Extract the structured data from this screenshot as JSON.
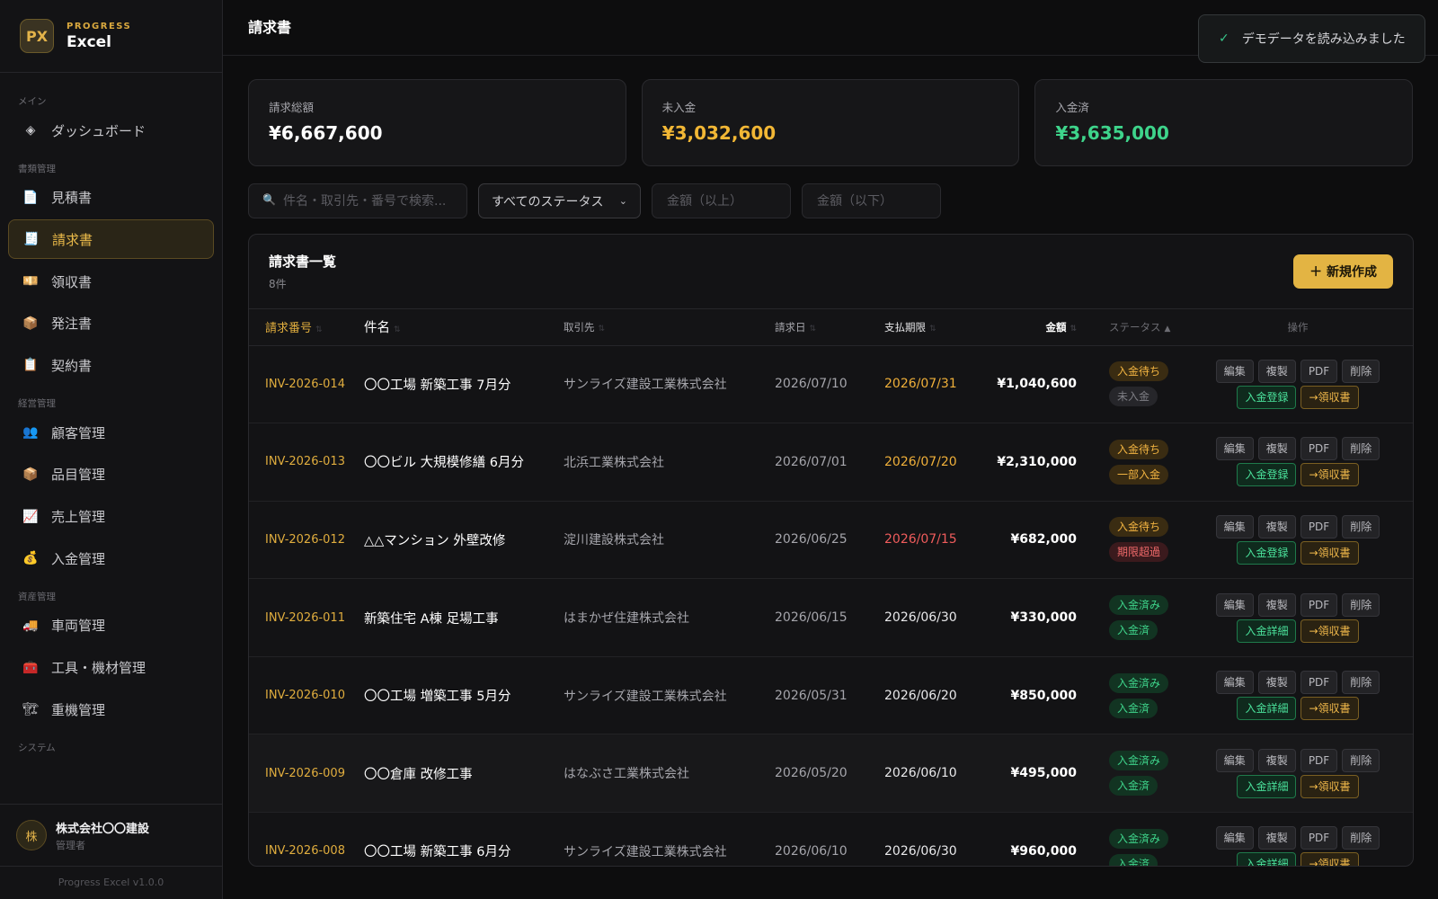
{
  "brand": {
    "logo": "PX",
    "sub": "PROGRESS",
    "name": "Excel"
  },
  "sidebar": {
    "sections": [
      {
        "label": "メイン",
        "items": [
          {
            "icon": "◈",
            "icon_name": "diamond-icon",
            "label": "ダッシュボード"
          }
        ]
      },
      {
        "label": "書類管理",
        "items": [
          {
            "icon": "📄",
            "icon_name": "document-icon",
            "label": "見積書"
          },
          {
            "icon": "🧾",
            "icon_name": "invoice-icon",
            "label": "請求書",
            "active": true
          },
          {
            "icon": "💴",
            "icon_name": "receipt-icon",
            "label": "領収書"
          },
          {
            "icon": "📦",
            "icon_name": "package-icon",
            "label": "発注書"
          },
          {
            "icon": "📋",
            "icon_name": "clipboard-icon",
            "label": "契約書"
          }
        ]
      },
      {
        "label": "経営管理",
        "items": [
          {
            "icon": "👥",
            "icon_name": "users-icon",
            "label": "顧客管理"
          },
          {
            "icon": "📦",
            "icon_name": "box-icon",
            "label": "品目管理"
          },
          {
            "icon": "📈",
            "icon_name": "chart-icon",
            "label": "売上管理"
          },
          {
            "icon": "💰",
            "icon_name": "money-bag-icon",
            "label": "入金管理"
          }
        ]
      },
      {
        "label": "資産管理",
        "items": [
          {
            "icon": "🚚",
            "icon_name": "truck-icon",
            "label": "車両管理"
          },
          {
            "icon": "🧰",
            "icon_name": "toolbox-icon",
            "label": "工具・機材管理"
          },
          {
            "icon": "🏗",
            "icon_name": "crane-icon",
            "label": "重機管理"
          }
        ]
      },
      {
        "label": "システム",
        "items": []
      }
    ],
    "user": {
      "avatar": "株",
      "name": "株式会社〇〇建設",
      "role": "管理者"
    },
    "version": "Progress Excel v1.0.0"
  },
  "header": {
    "title": "請求書"
  },
  "toast": {
    "icon": "✓",
    "message": "デモデータを読み込みました"
  },
  "stats": [
    {
      "label": "請求総額",
      "value": "¥6,667,600",
      "color": "#ffffff"
    },
    {
      "label": "未入金",
      "value": "¥3,032,600",
      "color": "#f2b735"
    },
    {
      "label": "入金済",
      "value": "¥3,635,000",
      "color": "#3ed48b"
    }
  ],
  "filters": {
    "search_placeholder": "件名・取引先・番号で検索...",
    "status_selected": "すべてのステータス",
    "amount_min_placeholder": "金額（以上）",
    "amount_max_placeholder": "金額（以下）"
  },
  "list": {
    "title": "請求書一覧",
    "count": "8件",
    "new_button": "＋ 新規作成",
    "columns": [
      "請求番号",
      "件名",
      "取引先",
      "請求日",
      "支払期限",
      "金額",
      "ステータス",
      "操作"
    ],
    "rows": [
      {
        "no": "INV-2026-014",
        "name": "〇〇工場 新築工事 7月分",
        "client": "サンライズ建設工業株式会社",
        "date": "2026/07/10",
        "due": "2026/07/31",
        "due_state": "warn",
        "amount": "¥1,040,600",
        "status1": "入金待ち",
        "status1_type": "wait",
        "status2": "未入金",
        "status2_type": "unpaid",
        "pay_action": "入金登録"
      },
      {
        "no": "INV-2026-013",
        "name": "〇〇ビル 大規模修繕 6月分",
        "client": "北浜工業株式会社",
        "date": "2026/07/01",
        "due": "2026/07/20",
        "due_state": "warn",
        "amount": "¥2,310,000",
        "status1": "入金待ち",
        "status1_type": "wait",
        "status2": "一部入金",
        "status2_type": "part",
        "pay_action": "入金登録"
      },
      {
        "no": "INV-2026-012",
        "name": "△△マンション 外壁改修",
        "client": "淀川建設株式会社",
        "date": "2026/06/25",
        "due": "2026/07/15",
        "due_state": "over",
        "amount": "¥682,000",
        "status1": "入金待ち",
        "status1_type": "wait",
        "status2": "期限超過",
        "status2_type": "over",
        "pay_action": "入金登録"
      },
      {
        "no": "INV-2026-011",
        "name": "新築住宅 A棟 足場工事",
        "client": "はまかぜ住建株式会社",
        "date": "2026/06/15",
        "due": "2026/06/30",
        "due_state": "normal",
        "amount": "¥330,000",
        "status1": "入金済み",
        "status1_type": "paid",
        "status2": "入金済",
        "status2_type": "paid",
        "pay_action": "入金詳細"
      },
      {
        "no": "INV-2026-010",
        "name": "〇〇工場 増築工事 5月分",
        "client": "サンライズ建設工業株式会社",
        "date": "2026/05/31",
        "due": "2026/06/20",
        "due_state": "normal",
        "amount": "¥850,000",
        "status1": "入金済み",
        "status1_type": "paid",
        "status2": "入金済",
        "status2_type": "paid",
        "pay_action": "入金詳細"
      },
      {
        "no": "INV-2026-009",
        "name": "〇〇倉庫 改修工事",
        "client": "はなぶさ工業株式会社",
        "date": "2026/05/20",
        "due": "2026/06/10",
        "due_state": "normal",
        "amount": "¥495,000",
        "status1": "入金済み",
        "status1_type": "paid",
        "status2": "入金済",
        "status2_type": "paid",
        "pay_action": "入金詳細",
        "alt": true
      },
      {
        "no": "INV-2026-008",
        "name": "〇〇工場 新築工事 6月分",
        "client": "サンライズ建設工業株式会社",
        "date": "2026/06/10",
        "due": "2026/06/30",
        "due_state": "normal",
        "amount": "¥960,000",
        "status1": "入金済み",
        "status1_type": "paid",
        "status2": "入金済",
        "status2_type": "paid",
        "pay_action": "入金詳細"
      }
    ],
    "row_actions": {
      "edit": "編集",
      "copy": "複製",
      "pdf": "PDF",
      "delete": "削除",
      "receipt": "→領収書"
    }
  }
}
